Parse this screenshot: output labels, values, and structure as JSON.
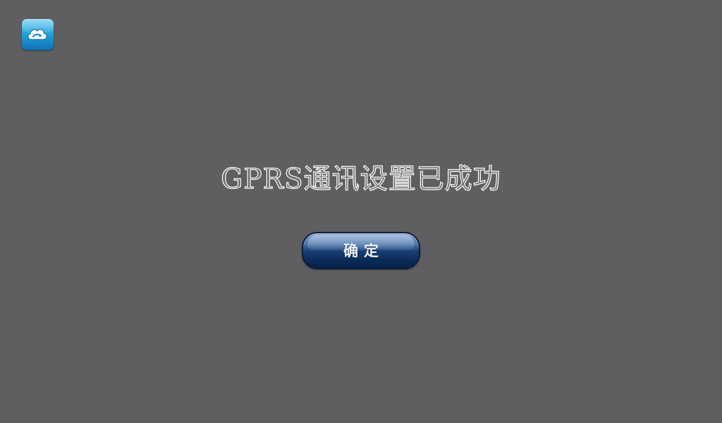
{
  "app": {
    "icon": "cloud-sync-icon",
    "accent_color": "#239fd8"
  },
  "dialog": {
    "message": "GPRS通讯设置已成功",
    "confirm_label": "确定",
    "button_color": "#183f73",
    "background_color": "#5f5e60"
  }
}
